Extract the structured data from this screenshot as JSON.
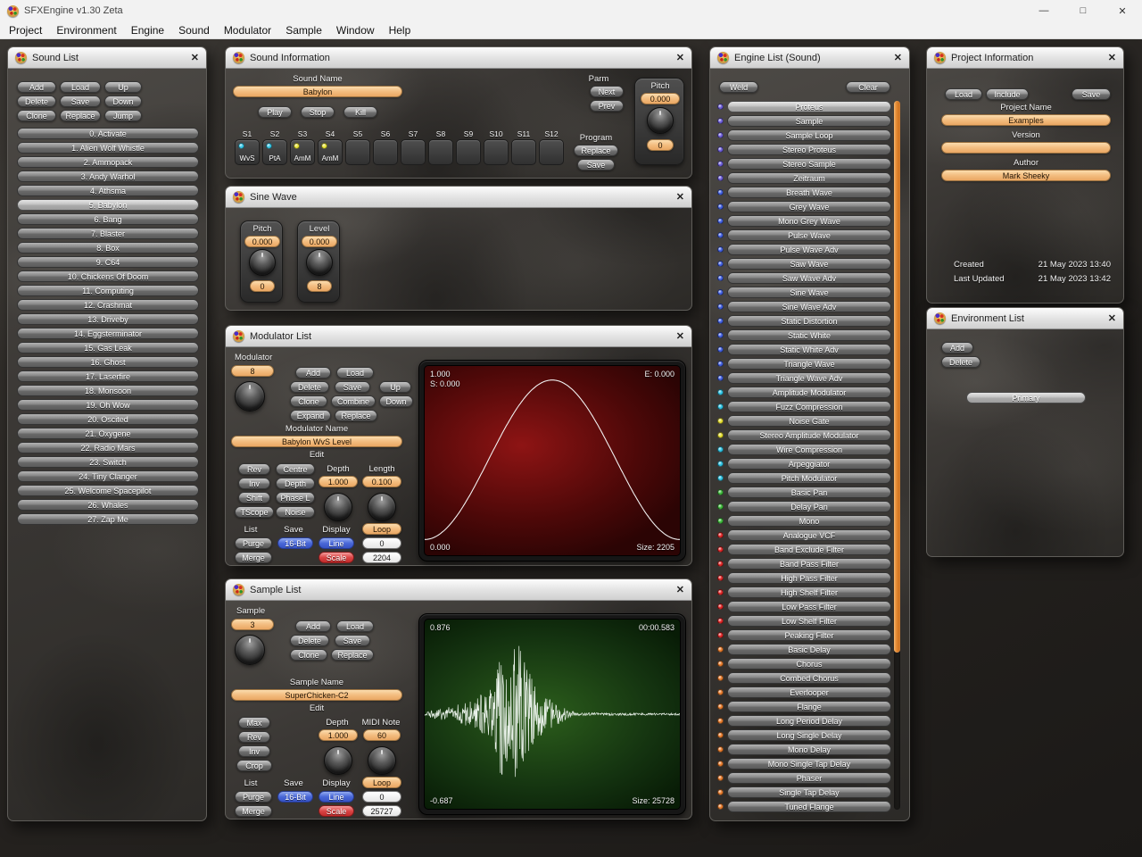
{
  "icons": {
    "close": "✕",
    "minimize": "—",
    "maximize": "□"
  },
  "window": {
    "title": "SFXEngine v1.30 Zeta"
  },
  "menu": [
    "Project",
    "Environment",
    "Engine",
    "Sound",
    "Modulator",
    "Sample",
    "Window",
    "Help"
  ],
  "sound_list": {
    "title": "Sound List",
    "buttons": [
      "Add",
      "Load",
      "Up",
      "Delete",
      "Save",
      "Down",
      "Clone",
      "Replace",
      "Jump"
    ],
    "selected_index": 5,
    "items": [
      "0. Activate",
      "1. Alien Wolf Whistle",
      "2. Ammopack",
      "3. Andy Warhol",
      "4. Athsma",
      "5. Babylon",
      "6. Bang",
      "7. Blaster",
      "8. Box",
      "9. C64",
      "10. Chickens Of Doom",
      "11. Computing",
      "12. Crashmat",
      "13. Driveby",
      "14. Eggsterminator",
      "15. Gas Leak",
      "16. Ghost",
      "17. Laserfire",
      "18. Monsoon",
      "19. Oh Wow",
      "20. Oscited",
      "21. Oxygene",
      "22. Radio Mars",
      "23. Switch",
      "24. Tiny Clanger",
      "25. Welcome Spacepilot",
      "26. Whales",
      "27. Zap Me"
    ]
  },
  "sound_info": {
    "title": "Sound Information",
    "sound_name_label": "Sound Name",
    "sound_name": "Babylon",
    "play": "Play",
    "stop": "Stop",
    "kill": "Kill",
    "parm_label": "Parm",
    "next": "Next",
    "prev": "Prev",
    "pitch_label": "Pitch",
    "pitch_value": "0.000",
    "pitch_offset": "0",
    "slot_labels": [
      "S1",
      "S2",
      "S3",
      "S4",
      "S5",
      "S6",
      "S7",
      "S8",
      "S9",
      "S10",
      "S11",
      "S12"
    ],
    "slots": [
      {
        "label": "WvS",
        "color": "#35c8e8"
      },
      {
        "label": "PtA",
        "color": "#35c8e8"
      },
      {
        "label": "AmM",
        "color": "#e8e435"
      },
      {
        "label": "AmM",
        "color": "#e8e435"
      }
    ],
    "program_label": "Program",
    "program_replace": "Replace",
    "program_save": "Save"
  },
  "sine_wave": {
    "title": "Sine Wave",
    "pitch_label": "Pitch",
    "pitch_value": "0.000",
    "pitch_offset": "0",
    "level_label": "Level",
    "level_value": "0.000",
    "level_offset": "8"
  },
  "modulator": {
    "title": "Modulator List",
    "index_label": "Modulator",
    "index_value": "8",
    "add": "Add",
    "load": "Load",
    "delete": "Delete",
    "save": "Save",
    "up": "Up",
    "clone": "Clone",
    "combine": "Combine",
    "down": "Down",
    "expand": "Expand",
    "replace": "Replace",
    "name_label": "Modulator Name",
    "name": "Babylon WvS Level",
    "edit_label": "Edit",
    "rev": "Rev",
    "inv": "Inv",
    "shift": "Shift",
    "tscope": "TScope",
    "centre": "Centre",
    "depth_btn": "Depth",
    "phase": "Phase L",
    "noise": "Noise",
    "depth_label": "Depth",
    "depth_value": "1.000",
    "length_label": "Length",
    "length_value": "0.100",
    "list_label": "List",
    "save_label": "Save",
    "display_label": "Display",
    "loop": "Loop",
    "purge": "Purge",
    "bits": "16-Bit",
    "line": "Line",
    "loop_value": "0",
    "merge": "Merge",
    "scale": "Scale",
    "size_value": "2204",
    "display": {
      "max": "1.000",
      "start": "S: 0.000",
      "end": "E: 0.000",
      "min": "0.000",
      "size": "Size: 2205"
    }
  },
  "sample": {
    "title": "Sample List",
    "index_label": "Sample",
    "index_value": "3",
    "add": "Add",
    "load": "Load",
    "delete": "Delete",
    "save": "Save",
    "clone": "Clone",
    "replace": "Replace",
    "name_label": "Sample Name",
    "name": "SuperChicken-C2",
    "edit_label": "Edit",
    "max": "Max",
    "rev": "Rev",
    "inv": "Inv",
    "crop": "Crop",
    "depth_label": "Depth",
    "depth_value": "1.000",
    "midi_label": "MIDI Note",
    "midi_value": "60",
    "list_label": "List",
    "save_label": "Save",
    "display_label": "Display",
    "loop": "Loop",
    "purge": "Purge",
    "bits": "16-Bit",
    "line": "Line",
    "loop_value": "0",
    "merge": "Merge",
    "scale": "Scale",
    "size_value": "25727",
    "display": {
      "max": "0.876",
      "time": "00:00.583",
      "min": "-0.687",
      "size": "Size: 25728"
    }
  },
  "engine_list": {
    "title": "Engine List (Sound)",
    "weld": "Weld",
    "clear": "Clear",
    "selected_index": 0,
    "items": [
      {
        "label": "Proteus",
        "color": "#6b5bd8"
      },
      {
        "label": "Sample",
        "color": "#6b5bd8"
      },
      {
        "label": "Sample Loop",
        "color": "#6b5bd8"
      },
      {
        "label": "Stereo Proteus",
        "color": "#6b5bd8"
      },
      {
        "label": "Stereo Sample",
        "color": "#6b5bd8"
      },
      {
        "label": "Zeitraum",
        "color": "#6b5bd8"
      },
      {
        "label": "Breath Wave",
        "color": "#3f5de0"
      },
      {
        "label": "Grey Wave",
        "color": "#3f5de0"
      },
      {
        "label": "Mono Grey Wave",
        "color": "#3f5de0"
      },
      {
        "label": "Pulse Wave",
        "color": "#3f5de0"
      },
      {
        "label": "Pulse Wave Adv",
        "color": "#3f5de0"
      },
      {
        "label": "Saw Wave",
        "color": "#3f5de0"
      },
      {
        "label": "Saw Wave Adv",
        "color": "#3f5de0"
      },
      {
        "label": "Sine Wave",
        "color": "#3f5de0"
      },
      {
        "label": "Sine Wave Adv",
        "color": "#3f5de0"
      },
      {
        "label": "Static Distortion",
        "color": "#3f5de0"
      },
      {
        "label": "Static White",
        "color": "#3f5de0"
      },
      {
        "label": "Static White Adv",
        "color": "#3f5de0"
      },
      {
        "label": "Triangle Wave",
        "color": "#3f5de0"
      },
      {
        "label": "Triangle Wave Adv",
        "color": "#3f5de0"
      },
      {
        "label": "Amplitude Modulator",
        "color": "#2cc4e4"
      },
      {
        "label": "Fuzz Compression",
        "color": "#2cc4e4"
      },
      {
        "label": "Noise Gate",
        "color": "#e6de2e"
      },
      {
        "label": "Stereo Amplitude Modulator",
        "color": "#e6de2e"
      },
      {
        "label": "Wire Compression",
        "color": "#2cc4e4"
      },
      {
        "label": "Arpeggiator",
        "color": "#2cc4e4"
      },
      {
        "label": "Pitch Modulator",
        "color": "#2cc4e4"
      },
      {
        "label": "Basic Pan",
        "color": "#3cb838"
      },
      {
        "label": "Delay Pan",
        "color": "#3cb838"
      },
      {
        "label": "Mono",
        "color": "#3cb838"
      },
      {
        "label": "Analogue VCF",
        "color": "#e02424"
      },
      {
        "label": "Band Exclude Filter",
        "color": "#e02424"
      },
      {
        "label": "Band Pass Filter",
        "color": "#e02424"
      },
      {
        "label": "High Pass Filter",
        "color": "#e02424"
      },
      {
        "label": "High Shelf Filter",
        "color": "#e02424"
      },
      {
        "label": "Low Pass Filter",
        "color": "#e02424"
      },
      {
        "label": "Low Shelf Filter",
        "color": "#e02424"
      },
      {
        "label": "Peaking Filter",
        "color": "#e02424"
      },
      {
        "label": "Basic Delay",
        "color": "#e87a28"
      },
      {
        "label": "Chorus",
        "color": "#e87a28"
      },
      {
        "label": "Combed Chorus",
        "color": "#e87a28"
      },
      {
        "label": "Everlooper",
        "color": "#e87a28"
      },
      {
        "label": "Flange",
        "color": "#e87a28"
      },
      {
        "label": "Long Period Delay",
        "color": "#e87a28"
      },
      {
        "label": "Long Single Delay",
        "color": "#e87a28"
      },
      {
        "label": "Mono Delay",
        "color": "#e87a28"
      },
      {
        "label": "Mono Single Tap Delay",
        "color": "#e87a28"
      },
      {
        "label": "Phaser",
        "color": "#e87a28"
      },
      {
        "label": "Single Tap Delay",
        "color": "#e87a28"
      },
      {
        "label": "Tuned Flange",
        "color": "#e87a28"
      }
    ]
  },
  "project_info": {
    "title": "Project Information",
    "load": "Load",
    "include": "Include",
    "save": "Save",
    "project_name_label": "Project Name",
    "project_name": "Examples",
    "version_label": "Version",
    "version": "",
    "author_label": "Author",
    "author": "Mark Sheeky",
    "created_label": "Created",
    "created": "21 May 2023 13:40",
    "updated_label": "Last Updated",
    "updated": "21 May 2023 13:42"
  },
  "environment_list": {
    "title": "Environment List",
    "add": "Add",
    "delete": "Delete",
    "selected_index": 0,
    "items": [
      "Primary"
    ]
  }
}
